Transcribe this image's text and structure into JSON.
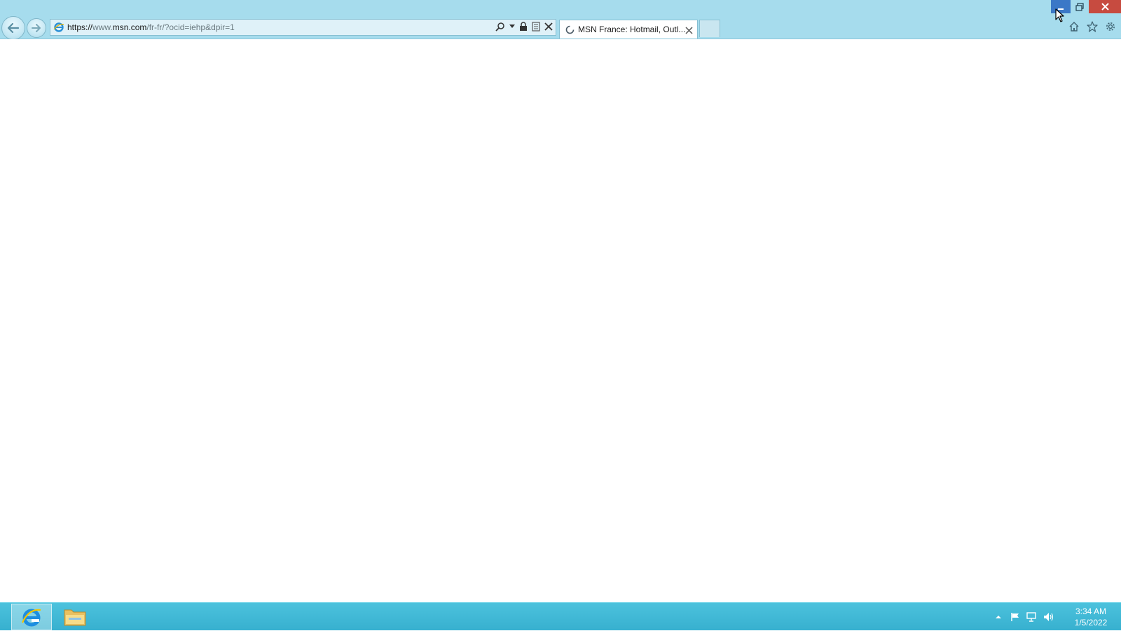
{
  "browser": {
    "address": {
      "scheme": "https://",
      "prefix": "www.",
      "domain": "msn.com",
      "path": "/fr-fr/?ocid=iehp&dpir=1"
    },
    "tab": {
      "title": "MSN France: Hotmail, Outl..."
    },
    "nav": {
      "back_icon": "back-arrow-icon",
      "forward_icon": "forward-arrow-icon"
    },
    "address_tools": [
      "search-icon",
      "dropdown-icon",
      "lock-icon",
      "compat-view-icon",
      "stop-icon"
    ],
    "command_icons": [
      "home-icon",
      "favorites-star-icon",
      "settings-gear-icon"
    ],
    "window_controls": [
      "minimize",
      "restore",
      "close"
    ]
  },
  "taskbar": {
    "apps": [
      "internet-explorer",
      "file-explorer"
    ],
    "tray_icons": [
      "show-hidden-icons",
      "action-center-flag",
      "network",
      "volume"
    ],
    "clock": {
      "time": "3:34 AM",
      "date": "1/5/2022"
    }
  },
  "colors": {
    "chrome": "#a6dced",
    "taskbar": "#3fb8d6",
    "close_button": "#c74b40",
    "minimize_hover": "#3b78c7"
  }
}
